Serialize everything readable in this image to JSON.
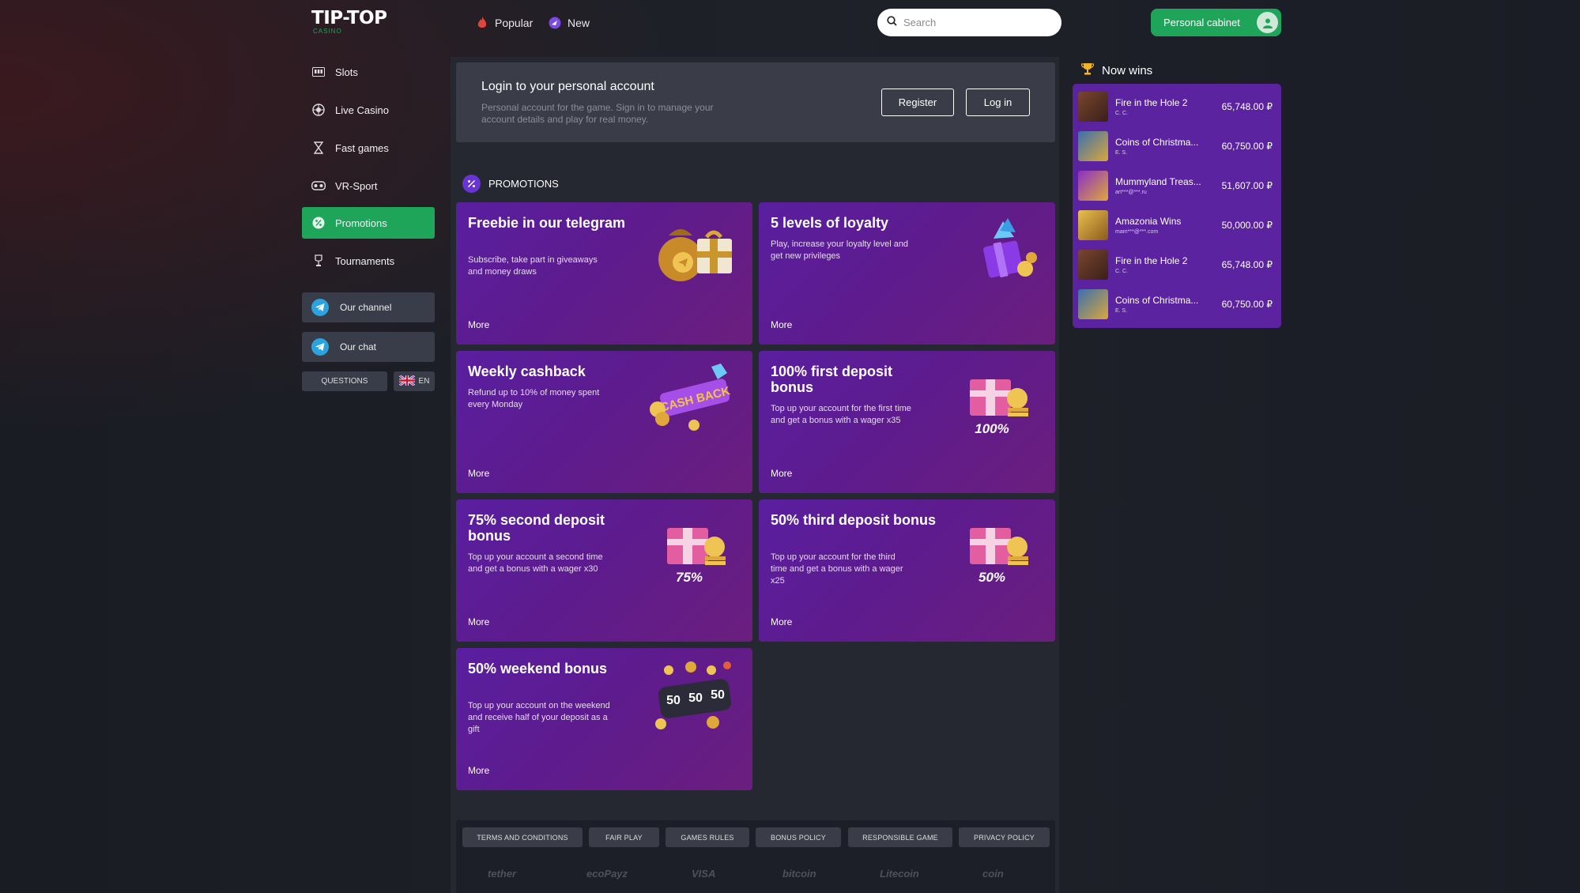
{
  "header": {
    "logo_main": "TIP-TOP",
    "logo_sub": "CASINO",
    "nav": [
      {
        "label": "Popular",
        "icon": "fire-icon"
      },
      {
        "label": "New",
        "icon": "new-badge-icon"
      }
    ],
    "search_placeholder": "Search",
    "cabinet_label": "Personal cabinet"
  },
  "sidebar": {
    "items": [
      {
        "label": "Slots",
        "icon": "slot-machine-icon",
        "active": false
      },
      {
        "label": "Live Casino",
        "icon": "roulette-icon",
        "active": false
      },
      {
        "label": "Fast games",
        "icon": "hourglass-icon",
        "active": false
      },
      {
        "label": "VR-Sport",
        "icon": "vr-headset-icon",
        "active": false
      },
      {
        "label": "Promotions",
        "icon": "percent-icon",
        "active": true
      },
      {
        "label": "Tournaments",
        "icon": "trophy-icon",
        "active": false
      }
    ],
    "channels": [
      {
        "label": "Our channel"
      },
      {
        "label": "Our chat"
      }
    ],
    "questions_label": "QUESTIONS",
    "language": "EN"
  },
  "login": {
    "title": "Login to your personal account",
    "description": "Personal account for the game. Sign in to manage your account details and play for real money.",
    "register_label": "Register",
    "login_label": "Log in"
  },
  "promotions": {
    "heading": "PROMOTIONS",
    "cards": [
      {
        "title": "Freebie in our telegram",
        "description": "Subscribe, take part in giveaways and money draws",
        "more": "More"
      },
      {
        "title": "5 levels of loyalty",
        "description": "Play, increase your loyalty level and get new privileges",
        "more": "More"
      },
      {
        "title": "Weekly cashback",
        "description": "Refund up to 10% of money spent every Monday",
        "more": "More",
        "art_text": "CASH BACK"
      },
      {
        "title": "100% first deposit bonus",
        "description": "Top up your account for the first time and get a bonus with a wager x35",
        "more": "More",
        "art_text": "100%"
      },
      {
        "title": "75% second deposit bonus",
        "description": "Top up your account a second time and get a bonus with a wager x30",
        "more": "More",
        "art_text": "75%"
      },
      {
        "title": "50% third deposit bonus",
        "description": "Top up your account for the third time and get a bonus with a wager x25",
        "more": "More",
        "art_text": "50%"
      },
      {
        "title": "50% weekend bonus",
        "description": "Top up your account on the weekend and receive half of your deposit as a gift",
        "more": "More",
        "art_text": "50"
      }
    ]
  },
  "footer": {
    "links": [
      "TERMS AND CONDITIONS",
      "FAIR PLAY",
      "GAMES RULES",
      "BONUS POLICY",
      "RESPONSIBLE GAME",
      "PRIVACY POLICY"
    ],
    "payments": [
      "tether",
      "ecoPayz",
      "VISA",
      "bitcoin",
      "Litecoin",
      "coin"
    ]
  },
  "wins": {
    "heading": "Now wins",
    "currency": "₽",
    "rows": [
      {
        "game": "Fire in the Hole 2",
        "user": "C. C.",
        "amount": "65,748.00",
        "thumb_color": "#6b3a2a"
      },
      {
        "game": "Coins of Christma...",
        "user": "E. S.",
        "amount": "60,750.00",
        "thumb_color": "#3b6fb0"
      },
      {
        "game": "Mummyland Treas...",
        "user": "art***@***.ru",
        "amount": "51,607.00",
        "thumb_color": "#8a2fc7"
      },
      {
        "game": "Amazonia Wins",
        "user": "mam***@***.com",
        "amount": "50,000.00",
        "thumb_color": "#d8a42a"
      },
      {
        "game": "Fire in the Hole 2",
        "user": "C. C.",
        "amount": "65,748.00",
        "thumb_color": "#6b3a2a"
      },
      {
        "game": "Coins of Christma...",
        "user": "E. S.",
        "amount": "60,750.00",
        "thumb_color": "#3b6fb0"
      }
    ]
  },
  "colors": {
    "accent_green": "#1fa55a",
    "promo_purple": "#5d1b8e",
    "wins_purple": "#5b239f",
    "background": "#1b1d26"
  }
}
